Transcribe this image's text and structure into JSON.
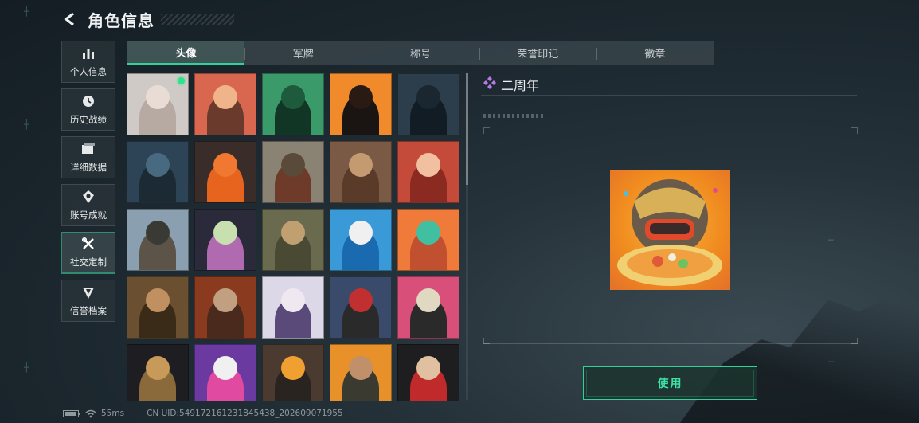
{
  "header": {
    "title": "角色信息",
    "back_icon": "back-arrow-icon"
  },
  "nav": {
    "items": [
      {
        "label": "个人信息",
        "icon": "bar-chart-icon",
        "active": false
      },
      {
        "label": "历史战绩",
        "icon": "history-clock-icon",
        "active": false
      },
      {
        "label": "详细数据",
        "icon": "folder-stack-icon",
        "active": false
      },
      {
        "label": "账号成就",
        "icon": "achievement-badge-icon",
        "active": false
      },
      {
        "label": "社交定制",
        "icon": "tools-cross-icon",
        "active": true
      },
      {
        "label": "信誉档案",
        "icon": "shield-gem-icon",
        "active": false
      }
    ]
  },
  "tabs": [
    {
      "label": "头像",
      "active": true
    },
    {
      "label": "军牌",
      "active": false
    },
    {
      "label": "称号",
      "active": false
    },
    {
      "label": "荣誉印记",
      "active": false
    },
    {
      "label": "徽章",
      "active": false
    }
  ],
  "avatars": [
    {
      "id": "avatar-1",
      "bg": "#cfcac6",
      "head": "#e8dcd4",
      "fig": "#b7aaa2",
      "selected": true
    },
    {
      "id": "avatar-2",
      "bg": "#d9674f",
      "head": "#f0b48a",
      "fig": "#6a3b2c",
      "selected": false
    },
    {
      "id": "avatar-3",
      "bg": "#3a9a6a",
      "head": "#1e5a3c",
      "fig": "#123626",
      "selected": false
    },
    {
      "id": "avatar-4",
      "bg": "#f08a2a",
      "head": "#2a1a14",
      "fig": "#1a1412",
      "selected": false
    },
    {
      "id": "avatar-5",
      "bg": "#2c3e4c",
      "head": "#1a2630",
      "fig": "#121c24",
      "selected": false
    },
    {
      "id": "avatar-6",
      "bg": "#2c4456",
      "head": "#486a80",
      "fig": "#1c2a34",
      "selected": false
    },
    {
      "id": "avatar-7",
      "bg": "#3a2c28",
      "head": "#f07830",
      "fig": "#e6641e",
      "selected": false
    },
    {
      "id": "avatar-8",
      "bg": "#8a8272",
      "head": "#5a4a3a",
      "fig": "#6e3a2a",
      "selected": false
    },
    {
      "id": "avatar-9",
      "bg": "#7a5a44",
      "head": "#c49a70",
      "fig": "#5a3a28",
      "selected": false
    },
    {
      "id": "avatar-10",
      "bg": "#c44a3a",
      "head": "#f0c0a0",
      "fig": "#8a2a20",
      "selected": false
    },
    {
      "id": "avatar-11",
      "bg": "#8aa0b0",
      "head": "#3a3a34",
      "fig": "#5c5448",
      "selected": false
    },
    {
      "id": "avatar-12",
      "bg": "#2a2a3a",
      "head": "#c8e0b0",
      "fig": "#b06ab0",
      "selected": false
    },
    {
      "id": "avatar-13",
      "bg": "#6a6a4e",
      "head": "#c0a070",
      "fig": "#4a4a34",
      "selected": false
    },
    {
      "id": "avatar-14",
      "bg": "#3a9ad8",
      "head": "#f0f0f0",
      "fig": "#1a6ab0",
      "selected": false
    },
    {
      "id": "avatar-15",
      "bg": "#f07a3a",
      "head": "#40c0a0",
      "fig": "#c05030",
      "selected": false
    },
    {
      "id": "avatar-16",
      "bg": "#6a5030",
      "head": "#c09060",
      "fig": "#3a2a18",
      "selected": false
    },
    {
      "id": "avatar-17",
      "bg": "#8a3a1e",
      "head": "#c0a080",
      "fig": "#4a2a1c",
      "selected": false
    },
    {
      "id": "avatar-18",
      "bg": "#dcd8e8",
      "head": "#f0e8f0",
      "fig": "#5a4a7a",
      "selected": false
    },
    {
      "id": "avatar-19",
      "bg": "#3a4a6a",
      "head": "#c03030",
      "fig": "#2a2a2a",
      "selected": false
    },
    {
      "id": "avatar-20",
      "bg": "#d8507a",
      "head": "#e0d8c0",
      "fig": "#2a2a2a",
      "selected": false
    },
    {
      "id": "avatar-21",
      "bg": "#1e1e22",
      "head": "#c89a5a",
      "fig": "#8a6a3a",
      "selected": false
    },
    {
      "id": "avatar-22",
      "bg": "#6a3aa0",
      "head": "#f0f0f0",
      "fig": "#e04aa0",
      "selected": false
    },
    {
      "id": "avatar-23",
      "bg": "#4a3a30",
      "head": "#f0a030",
      "fig": "#2a2420",
      "selected": false
    },
    {
      "id": "avatar-24",
      "bg": "#e8902a",
      "head": "#c0906a",
      "fig": "#3a3a30",
      "selected": false
    },
    {
      "id": "avatar-25",
      "bg": "#1e1e20",
      "head": "#e0c0a0",
      "fig": "#c02a2a",
      "selected": false
    }
  ],
  "detail": {
    "name": "二周年",
    "title_icon": "diamond-cluster-icon"
  },
  "use_button": {
    "label": "使用"
  },
  "status": {
    "ping": "55ms",
    "uid": "CN UID:549172161231845438_202609071955",
    "battery_level": 0.9
  }
}
